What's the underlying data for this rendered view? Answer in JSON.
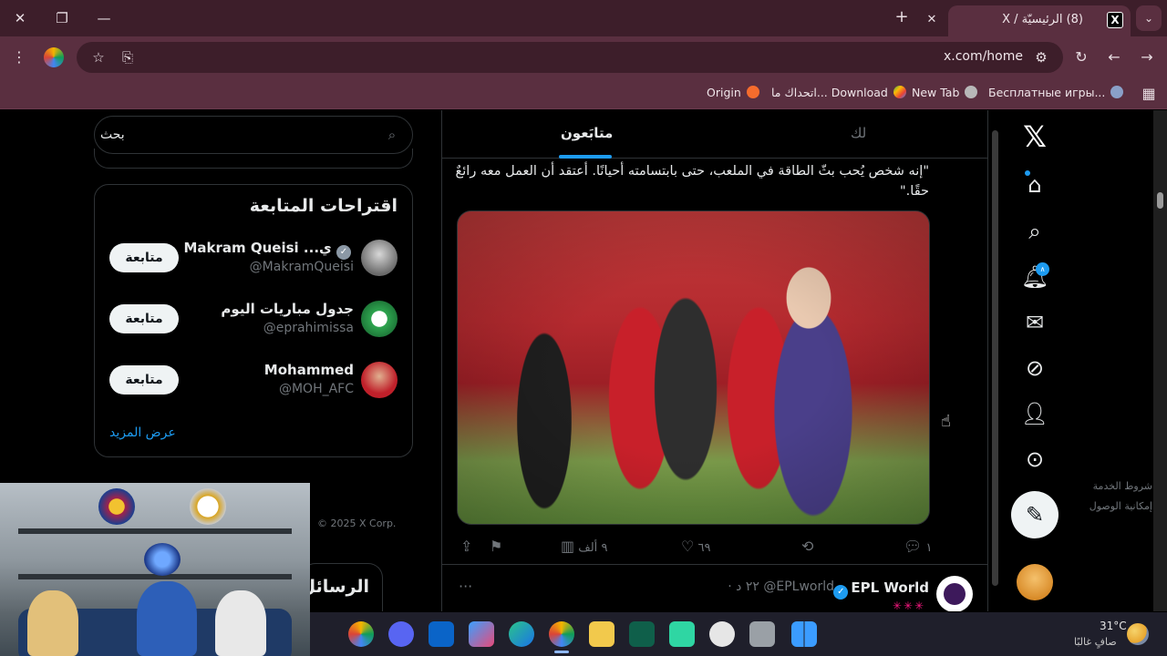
{
  "browser": {
    "tab_title": "(8) الرئيسيّة / X",
    "tab_favicon": "X",
    "url": "x.com/home",
    "bookmarks": [
      "Бесплатные игры...",
      "New Tab",
      "اتحداك ما... Download",
      "Origin"
    ]
  },
  "nav": {
    "notification_count": "∧"
  },
  "timeline": {
    "tabs": {
      "following": "متابَعون",
      "for_you": "لك"
    },
    "tweet": {
      "text": "\"إنه شخص يُحب بثّ الطاقة في الملعب، حتى بابتسامته أحيانًا. أعتقد أن العمل معه رائعٌ حقًا.\"",
      "replies": "١",
      "likes": "٦٩",
      "views": "٩ ألف"
    },
    "next_tweet": {
      "name": "EPL World",
      "handle": "@EPLworld",
      "time": "· ٢٢ د",
      "emoji": "✳✳✳"
    }
  },
  "sidebar": {
    "search_placeholder": "بحث",
    "who_to_follow": {
      "title": "اقتراحات المتابعة",
      "follow_label": "متابعة",
      "show_more": "عرض المزيد",
      "accounts": [
        {
          "name": "Makram Queisi ...ي",
          "handle": "@MakramQueisi"
        },
        {
          "name": "جدول مباريات اليوم",
          "handle": "@eprahimissa"
        },
        {
          "name": "Mohammed",
          "handle": "@MOH_AFC"
        }
      ]
    },
    "footer": {
      "links": [
        "شروط الخدمة",
        "إمكانية الوصول"
      ],
      "copyright": "© 2025 X Corp."
    },
    "messages_label": "الرسائل"
  },
  "taskbar": {
    "temperature": "31°C",
    "weather": "صافٍ غالبًا"
  },
  "colors": {
    "accent": "#1d9bf0",
    "chrome_dark": "#3d1e2a",
    "chrome": "#5a2f40"
  }
}
